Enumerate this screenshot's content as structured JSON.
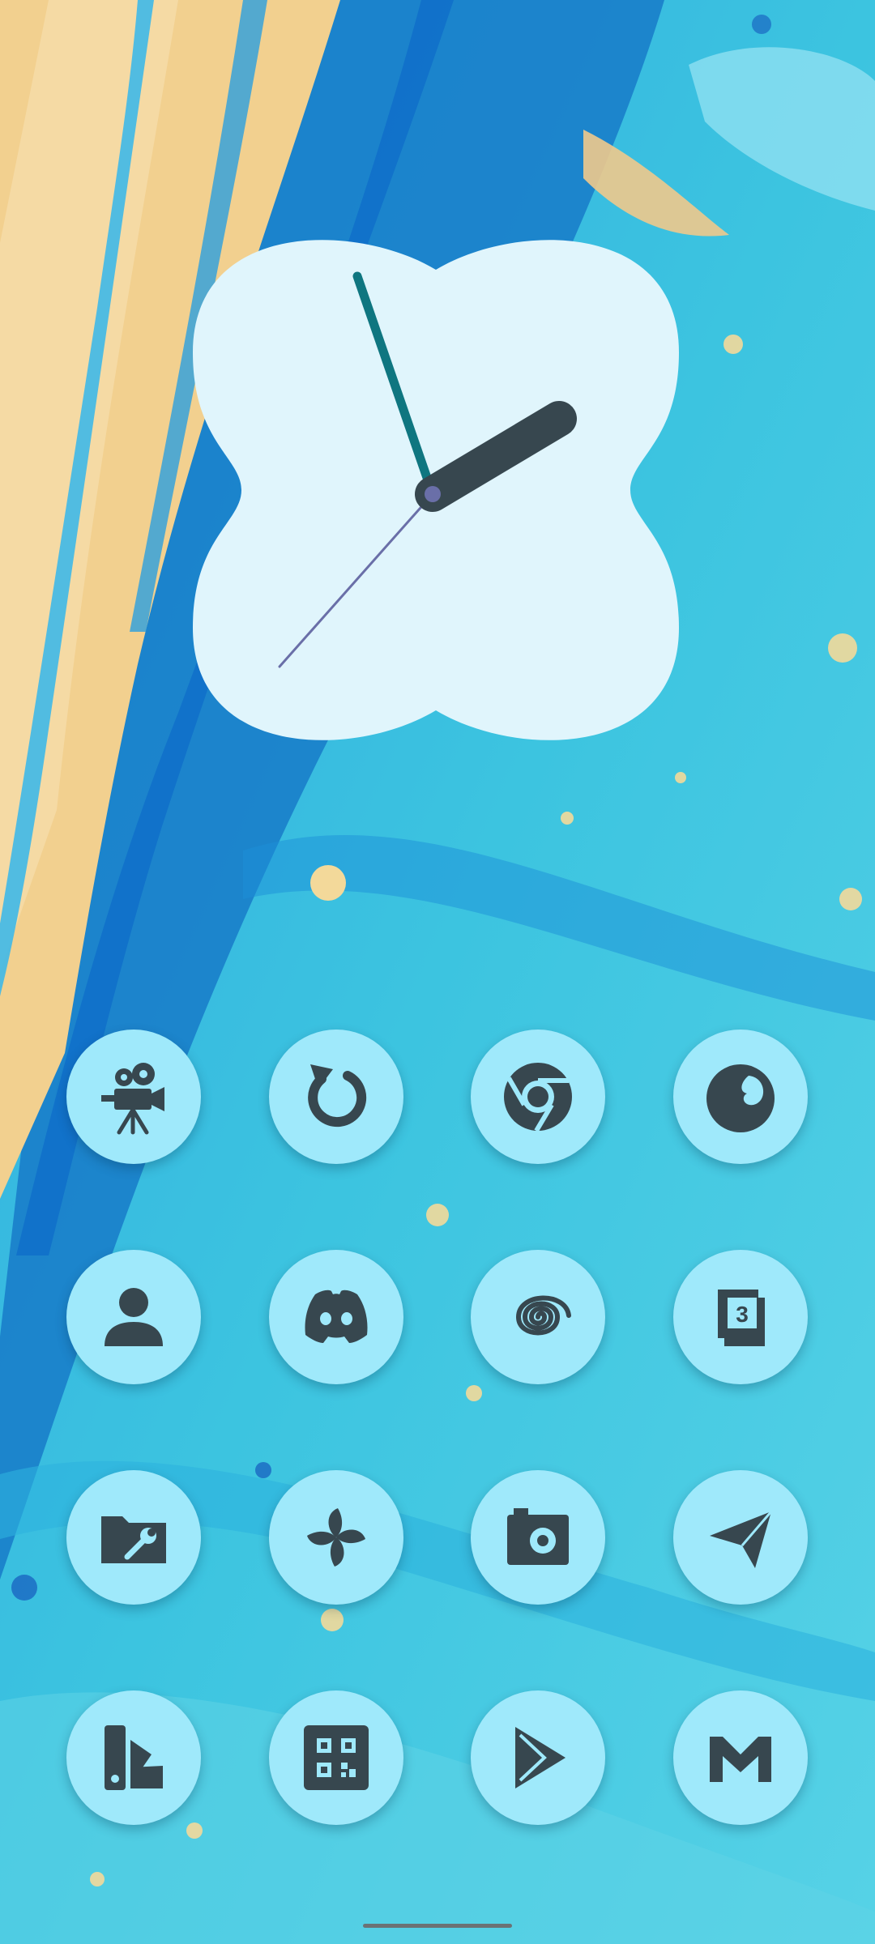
{
  "home_screen": {
    "clock_widget": {
      "time_shown": "1:59:38",
      "colors": {
        "face": "#e0f5fc",
        "hour_hand": "#37474f",
        "minute_hand": "#0f7680",
        "second_hand": "#6a6fa8",
        "center_dot": "#6a6fa8"
      }
    },
    "icon_rows": [
      [
        {
          "id": "video-camera",
          "icon": "video-camera-icon"
        },
        {
          "id": "refresh",
          "icon": "refresh-arrow-icon"
        },
        {
          "id": "chrome",
          "icon": "chrome-icon"
        },
        {
          "id": "firefox",
          "icon": "firefox-icon"
        }
      ],
      [
        {
          "id": "contacts",
          "icon": "person-icon"
        },
        {
          "id": "discord",
          "icon": "discord-icon"
        },
        {
          "id": "spiral",
          "icon": "spiral-icon"
        },
        {
          "id": "calendar",
          "icon": "calendar-icon",
          "badge": "3"
        }
      ],
      [
        {
          "id": "file-manager",
          "icon": "folder-wrench-icon"
        },
        {
          "id": "pinwheel",
          "icon": "pinwheel-icon"
        },
        {
          "id": "camera",
          "icon": "camera-icon"
        },
        {
          "id": "telegram",
          "icon": "paper-plane-icon"
        }
      ],
      [
        {
          "id": "wallpapers",
          "icon": "color-swatch-icon"
        },
        {
          "id": "qr-scanner",
          "icon": "qr-code-icon"
        },
        {
          "id": "play-store",
          "icon": "play-store-icon"
        },
        {
          "id": "gmail",
          "icon": "gmail-icon"
        }
      ]
    ],
    "colors": {
      "icon_background": "#9fe9fb",
      "icon_glyph": "#37474f",
      "nav_handle": "#6b7275"
    }
  }
}
